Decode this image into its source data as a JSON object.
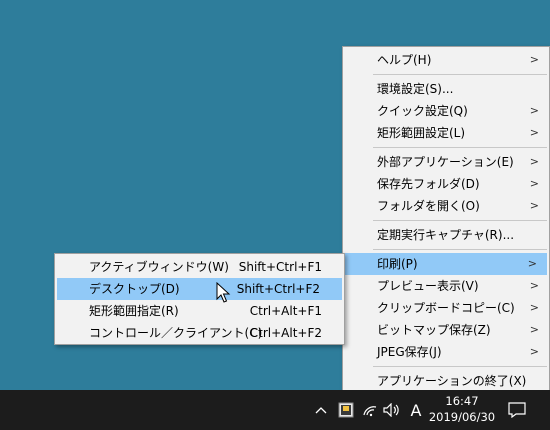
{
  "main_menu": {
    "help": "ヘルプ(H)",
    "preferences": "環境設定(S)...",
    "quick_settings": "クイック設定(Q)",
    "region_settings": "矩形範囲設定(L)",
    "external_apps": "外部アプリケーション(E)",
    "save_folder": "保存先フォルダ(D)",
    "open_folder": "フォルダを開く(O)",
    "scheduled_capture": "定期実行キャプチャ(R)...",
    "print": "印刷(P)",
    "preview": "プレビュー表示(V)",
    "clipboard_copy": "クリップボードコピー(C)",
    "bitmap_save": "ビットマップ保存(Z)",
    "jpeg_save": "JPEG保存(J)",
    "exit": "アプリケーションの終了(X)"
  },
  "sub_menu": {
    "items": [
      {
        "label": "アクティブウィンドウ(W)",
        "shortcut": "Shift+Ctrl+F1"
      },
      {
        "label": "デスクトップ(D)",
        "shortcut": "Shift+Ctrl+F2"
      },
      {
        "label": "矩形範囲指定(R)",
        "shortcut": "Ctrl+Alt+F1"
      },
      {
        "label": "コントロール／クライアント(C)",
        "shortcut": "Ctrl+Alt+F2"
      }
    ]
  },
  "taskbar": {
    "ime_mode": "A",
    "time": "16:47",
    "date": "2019/06/30"
  },
  "icons": {
    "submenu_arrow": "chevron-right-icon",
    "tray_overflow": "chevron-up-icon",
    "app_tray": "capture-app-icon",
    "network": "wifi-icon",
    "volume": "speaker-icon",
    "notifications": "notification-icon"
  }
}
